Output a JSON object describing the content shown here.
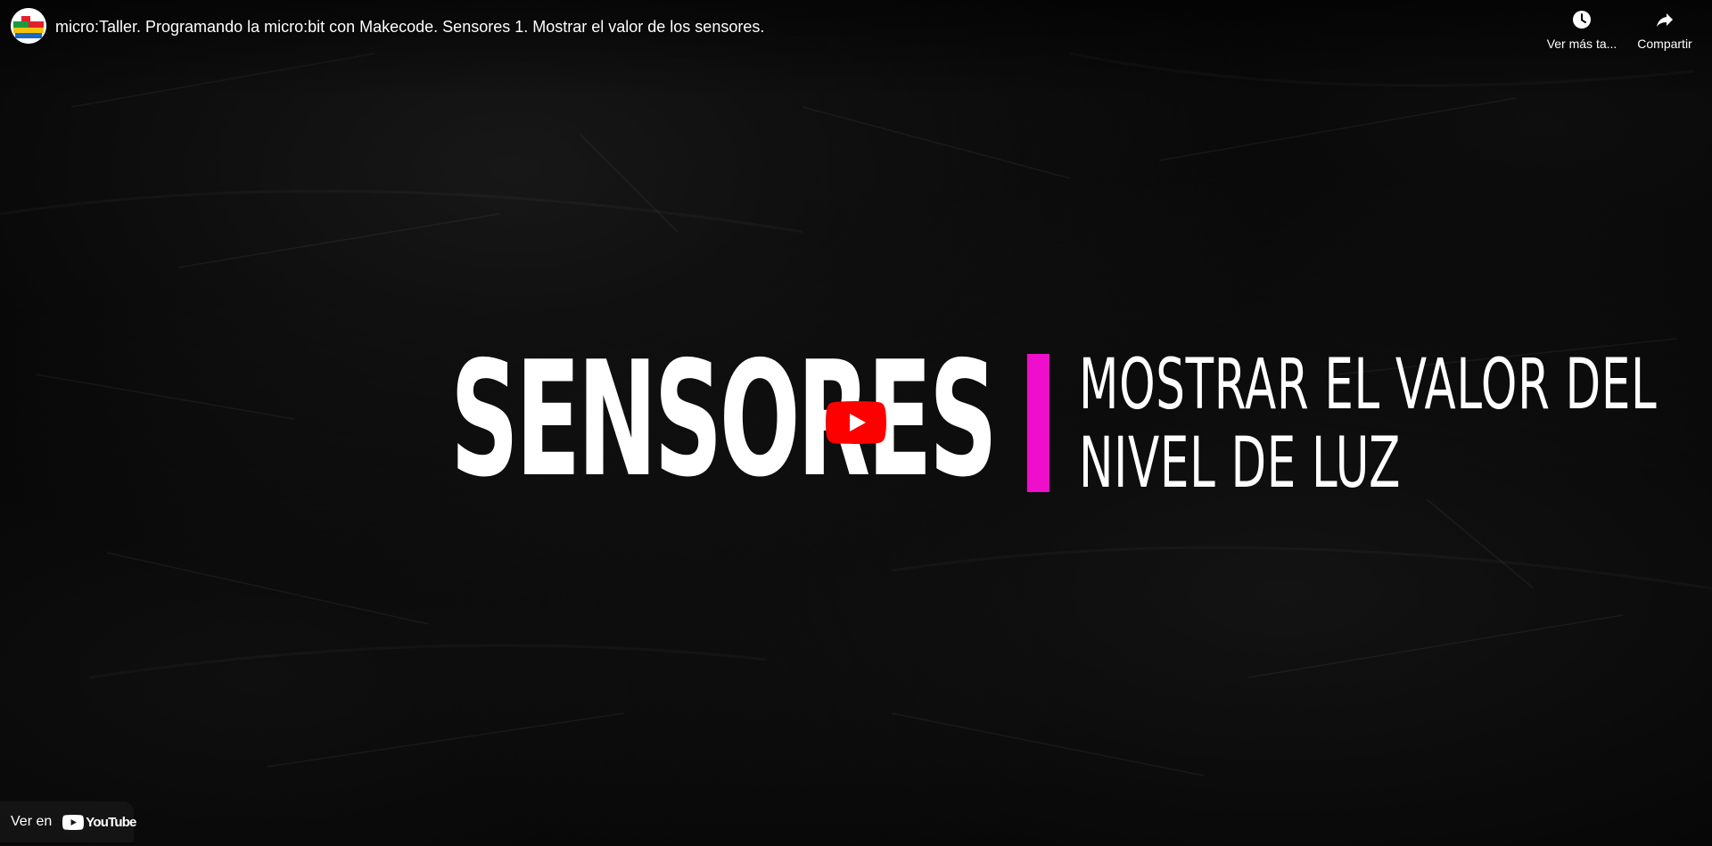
{
  "header": {
    "title": "micro:Taller. Programando la micro:bit con Makecode. Sensores 1. Mostrar el valor de los sensores.",
    "actions": [
      {
        "label": "Ver más ta...",
        "icon": "clock-icon"
      },
      {
        "label": "Compartir",
        "icon": "share-icon"
      }
    ]
  },
  "thumbnail": {
    "big_word": "SENSORES",
    "line1": "MOSTRAR EL VALOR DEL",
    "line2": "NIVEL DE LUZ",
    "accent_color": "#ee0ecb"
  },
  "player": {
    "play_icon": "play-icon",
    "play_color": "#ff0000"
  },
  "watch_on": {
    "label": "Ver en",
    "logo_text": "YouTube"
  }
}
